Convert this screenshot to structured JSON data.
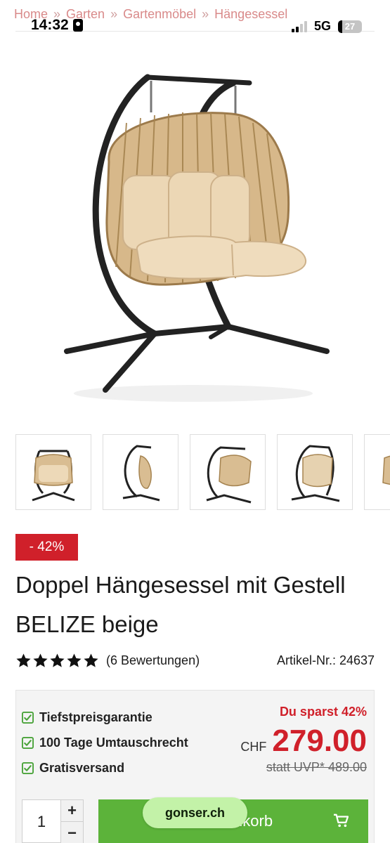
{
  "status_bar": {
    "time": "14:32",
    "network": "5G",
    "battery": "27"
  },
  "breadcrumb": [
    "Home",
    "Garten",
    "Gartenmöbel",
    "Hängesessel"
  ],
  "product": {
    "discount_badge": "- 42%",
    "title": "Doppel Hängesessel mit Gestell BELIZE beige",
    "rating": 5,
    "reviews": "(6 Bewertungen)",
    "article_number": "Artikel-Nr.: 24637"
  },
  "benefits": [
    "Tiefstpreisgarantie",
    "100 Tage Umtauschrecht",
    "Gratisversand"
  ],
  "pricing": {
    "savings": "Du sparst 42%",
    "currency": "CHF",
    "price": "279.00",
    "uvp": "statt UVP* 489.00"
  },
  "cart": {
    "quantity": "1",
    "plus": "+",
    "minus": "−",
    "button_label": "In den Warenkorb"
  },
  "browser": {
    "domain": "gonser.ch"
  },
  "colors": {
    "accent_red": "#d0202a",
    "cart_green": "#5cb33a",
    "check_green": "#4aa33a"
  }
}
